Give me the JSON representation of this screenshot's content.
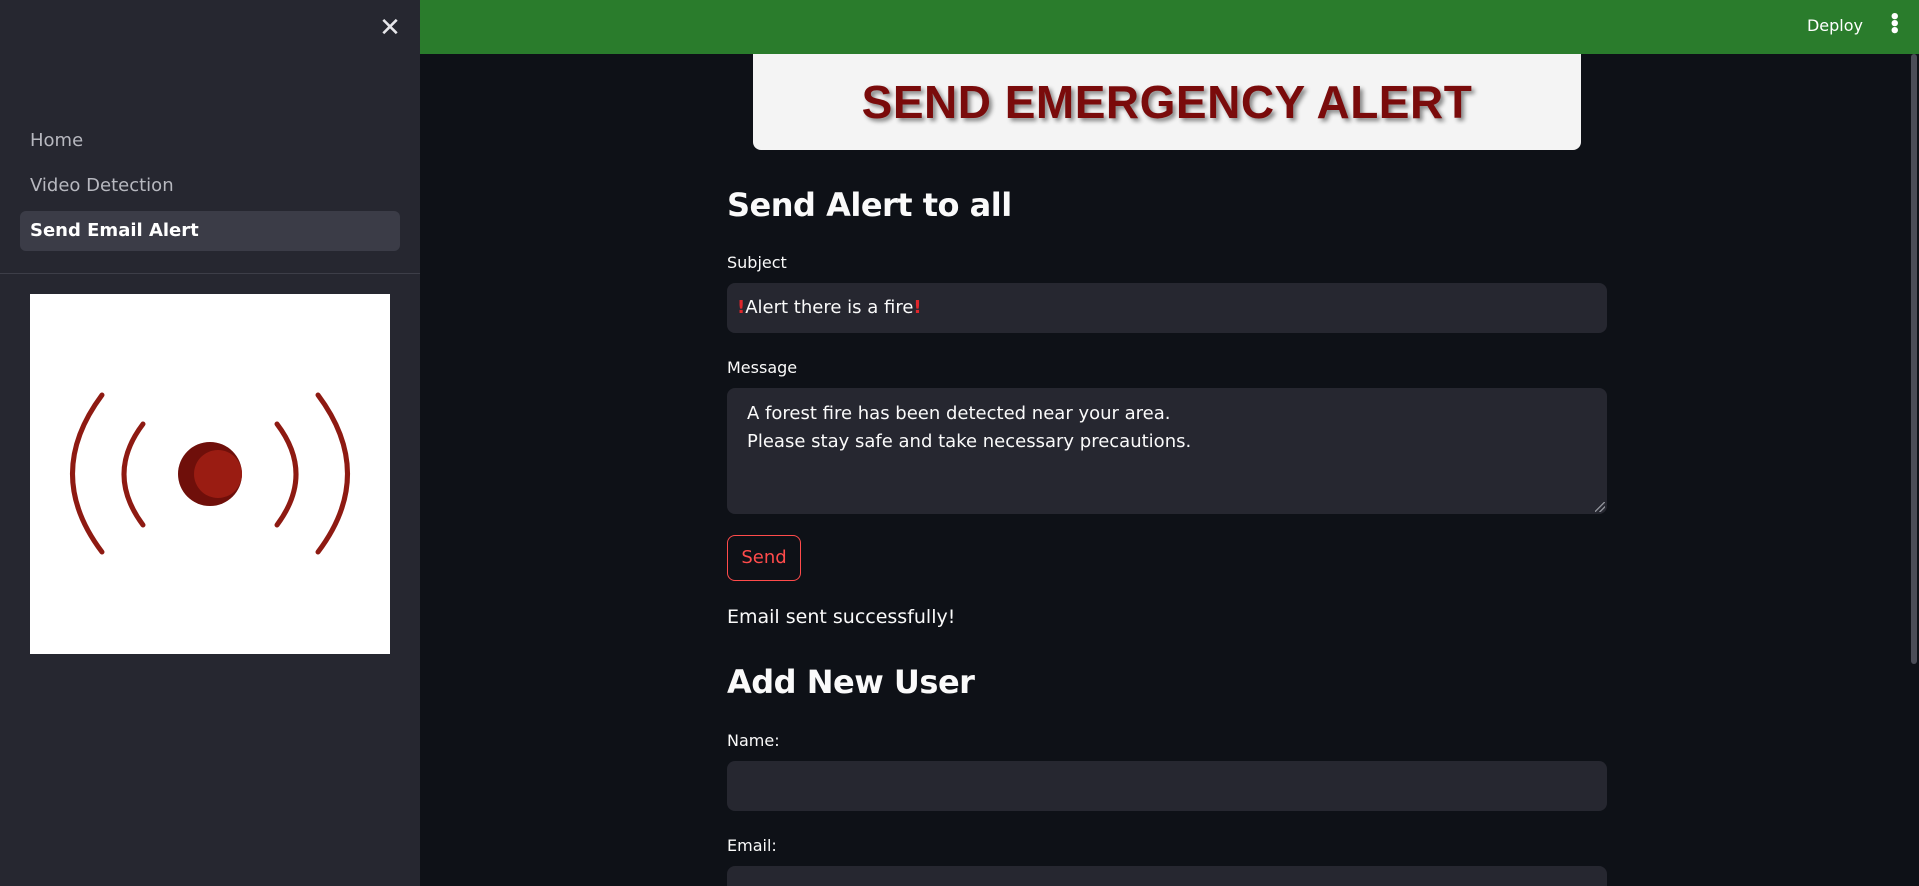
{
  "sidebar": {
    "close_icon": "close-icon",
    "items": [
      {
        "label": "Home",
        "active": false
      },
      {
        "label": "Video Detection",
        "active": false
      },
      {
        "label": "Send Email Alert",
        "active": true
      }
    ],
    "image_icon": "alarm-signal-icon"
  },
  "header": {
    "deploy_label": "Deploy",
    "menu_icon": "kebab-menu-icon",
    "background": "#2a7c2c"
  },
  "banner": {
    "title": "SEND EMERGENCY ALERT"
  },
  "alert_form": {
    "title": "Send Alert to all",
    "subject_label": "Subject",
    "subject_value": "Alert there is a fire",
    "message_label": "Message",
    "message_lines": [
      "A forest fire has been detected near your area.",
      "Please stay safe and take necessary precautions."
    ],
    "send_label": "Send",
    "status": "Email sent successfully!"
  },
  "user_form": {
    "title": "Add New User",
    "name_label": "Name:",
    "name_value": "",
    "email_label": "Email:",
    "email_value": ""
  },
  "colors": {
    "accent": "#ff4b4b",
    "banner_text": "#7a0b0b",
    "alarm_red": "#8e1a12"
  }
}
